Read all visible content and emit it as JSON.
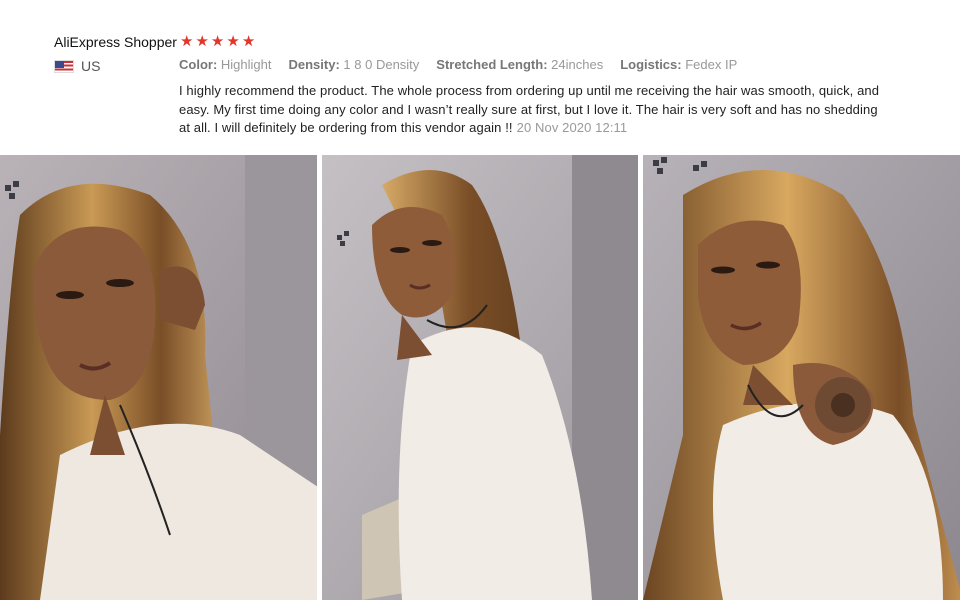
{
  "review": {
    "reviewer": "AliExpress Shopper",
    "rating": 5,
    "country": "US",
    "attributes": [
      {
        "key": "Color:",
        "value": "Highlight"
      },
      {
        "key": "Density:",
        "value": "1 8 0 Density"
      },
      {
        "key": "Stretched Length:",
        "value": "24inches"
      },
      {
        "key": "Logistics:",
        "value": "Fedex IP"
      }
    ],
    "text": "I highly recommend the product. The whole process from ordering up until me receiving the hair was smooth, quick, and easy. My first time doing any color and I wasn’t really sure at first, but I love it. The hair is very soft and has no shedding at all. I will definitely be ordering from this vendor again !!",
    "date": "20 Nov 2020 12:11"
  },
  "colors": {
    "star": "#e2362b",
    "wall": "#a9a4aa",
    "sweater": "#f0ebe4",
    "skin": "#8a5a3a",
    "hair_dark": "#6b4522",
    "hair_light": "#d8a860"
  }
}
